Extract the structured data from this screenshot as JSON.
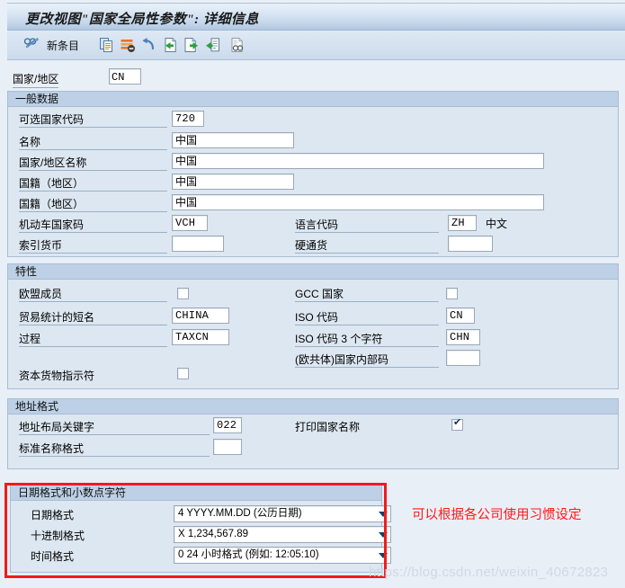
{
  "window": {
    "title": "更改视图\"国家全局性参数\": 详细信息"
  },
  "toolbar": {
    "items": [
      {
        "name": "display-change-icon",
        "label": "",
        "icon": "glasses-pencil-icon"
      },
      {
        "name": "new-entries-button",
        "label": "新条目",
        "icon": ""
      },
      {
        "name": "copy-icon",
        "label": "",
        "icon": "copy-icon"
      },
      {
        "name": "delete-row-icon",
        "label": "",
        "icon": "delete-row-icon"
      },
      {
        "name": "undo-icon",
        "label": "",
        "icon": "undo-icon"
      },
      {
        "name": "previous-entry-icon",
        "label": "",
        "icon": "previous-entry-icon"
      },
      {
        "name": "next-entry-icon",
        "label": "",
        "icon": "next-entry-icon"
      },
      {
        "name": "other-entry-icon",
        "label": "",
        "icon": "other-entry-icon"
      },
      {
        "name": "display-details-icon",
        "label": "",
        "icon": "binoculars-page-icon"
      }
    ]
  },
  "country_key": {
    "label": "国家/地区",
    "value": "CN"
  },
  "general_data": {
    "title": "一般数据",
    "alt_country_code": {
      "label": "可选国家代码",
      "value": "720"
    },
    "name": {
      "label": "名称",
      "value": "中国"
    },
    "country_name": {
      "label": "国家/地区名称",
      "value": "中国"
    },
    "nationality": {
      "label": "国籍（地区）",
      "value": "中国"
    },
    "nationality2": {
      "label": "国籍（地区）",
      "value": "中国"
    },
    "vehicle_country_key": {
      "label": "机动车国家码",
      "value": "VCH"
    },
    "language_key": {
      "label": "语言代码",
      "value": "ZH",
      "text": "中文"
    },
    "index_currency": {
      "label": "索引货币",
      "value": ""
    },
    "hard_currency": {
      "label": "硬通货",
      "value": ""
    }
  },
  "properties": {
    "title": "特性",
    "eu_member": {
      "label": "欧盟成员",
      "checked": false
    },
    "gcc_country": {
      "label": "GCC 国家",
      "checked": false
    },
    "trade_stat_short_name": {
      "label": "贸易统计的短名",
      "value": "CHINA"
    },
    "iso_code": {
      "label": "ISO 代码",
      "value": "CN"
    },
    "procedure": {
      "label": "过程",
      "value": "TAXCN"
    },
    "iso_code_3": {
      "label": "ISO 代码 3 个字符",
      "value": "CHN"
    },
    "ec_internal_code": {
      "label": "(欧共体)国家内部码",
      "value": ""
    },
    "capital_goods_indicator": {
      "label": "资本货物指示符",
      "checked": false
    }
  },
  "address_format": {
    "title": "地址格式",
    "address_layout_key": {
      "label": "地址布局关键字",
      "value": "022"
    },
    "print_country_name": {
      "label": "打印国家名称",
      "checked": true
    },
    "standard_name_format": {
      "label": "标准名称格式",
      "value": ""
    }
  },
  "date_decimal": {
    "title": "日期格式和小数点字符",
    "date_format": {
      "label": "日期格式",
      "value": "4 YYYY.MM.DD (公历日期)"
    },
    "decimal_format": {
      "label": "十进制格式",
      "value": "X 1,234,567.89"
    },
    "time_format": {
      "label": "时间格式",
      "value": "0 24 小时格式 (例如: 12:05:10)"
    }
  },
  "annotation": {
    "text": "可以根据各公司使用习惯设定",
    "color": "#ff1a1a"
  },
  "watermark": {
    "text": "https://blog.csdn.net/weixin_40672823"
  }
}
